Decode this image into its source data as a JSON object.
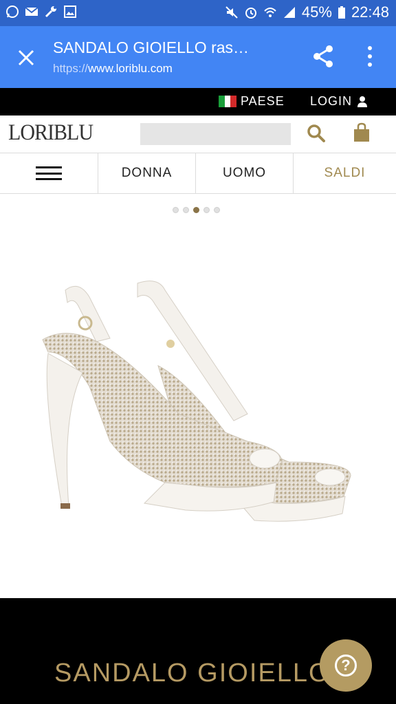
{
  "status_bar": {
    "battery": "45%",
    "time": "22:48",
    "left_icons": [
      "whatsapp-icon",
      "mail-icon",
      "wrench-icon",
      "gallery-icon"
    ],
    "right_icons": [
      "mute-icon",
      "alarm-icon",
      "wifi-icon",
      "signal-icon",
      "battery-icon"
    ]
  },
  "custom_tab": {
    "title": "SANDALO GIOIELLO ras…",
    "url_scheme": "https://",
    "url_host": "www.loriblu.com",
    "bar_color": "#4285f4"
  },
  "top_strip": {
    "country_label": "PAESE",
    "login_label": "LOGIN"
  },
  "header": {
    "logo": "LORIBLU",
    "search_placeholder": ""
  },
  "nav": {
    "items": [
      "DONNA",
      "UOMO",
      "SALDI"
    ],
    "highlight_color": "#a0894f"
  },
  "gallery": {
    "slide_count": 5,
    "active_slide": 3
  },
  "product": {
    "title": "SANDALO GIOIELLO",
    "accent": "#b59a63"
  },
  "help": {
    "label": "?"
  }
}
